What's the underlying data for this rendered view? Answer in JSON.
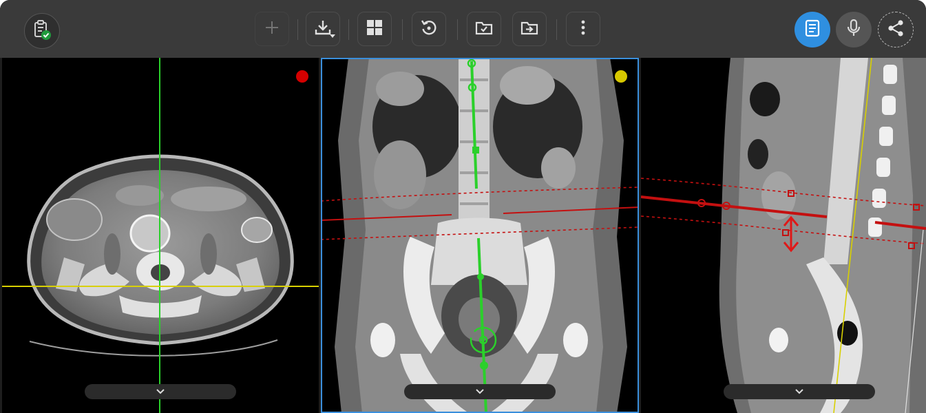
{
  "app": {
    "name": "medical-image-viewer"
  },
  "toolbar": {
    "left": {
      "icon": "clipboard-check-icon"
    },
    "center_buttons": [
      {
        "name": "add",
        "icon": "plus-icon",
        "enabled": false
      },
      {
        "name": "download",
        "icon": "download-icon",
        "enabled": true
      },
      {
        "name": "layout",
        "icon": "grid-layout-icon",
        "enabled": true
      },
      {
        "name": "reset",
        "icon": "rotate-reset-icon",
        "enabled": true
      },
      {
        "name": "folder-check",
        "icon": "folder-check-icon",
        "enabled": true
      },
      {
        "name": "folder-export",
        "icon": "folder-arrow-icon",
        "enabled": true
      },
      {
        "name": "more",
        "icon": "more-vertical-icon",
        "enabled": true
      }
    ],
    "right": [
      {
        "name": "report",
        "icon": "document-icon",
        "active": true
      },
      {
        "name": "voice",
        "icon": "microphone-icon",
        "active": false
      },
      {
        "name": "share",
        "icon": "share-icon",
        "active": false
      }
    ]
  },
  "viewports": [
    {
      "name": "axial",
      "indicator_color": "#d40000",
      "active": false
    },
    {
      "name": "coronal",
      "indicator_color": "#d8c800",
      "active": true
    },
    {
      "name": "sagittal",
      "indicator_color": "",
      "active": false
    }
  ],
  "colors": {
    "toolbar_bg": "#3a3a3a",
    "accent_blue": "#2f8fe0",
    "crosshair_green": "#2bd02b",
    "crosshair_yellow": "#d8d000",
    "plane_red": "#c41010"
  }
}
